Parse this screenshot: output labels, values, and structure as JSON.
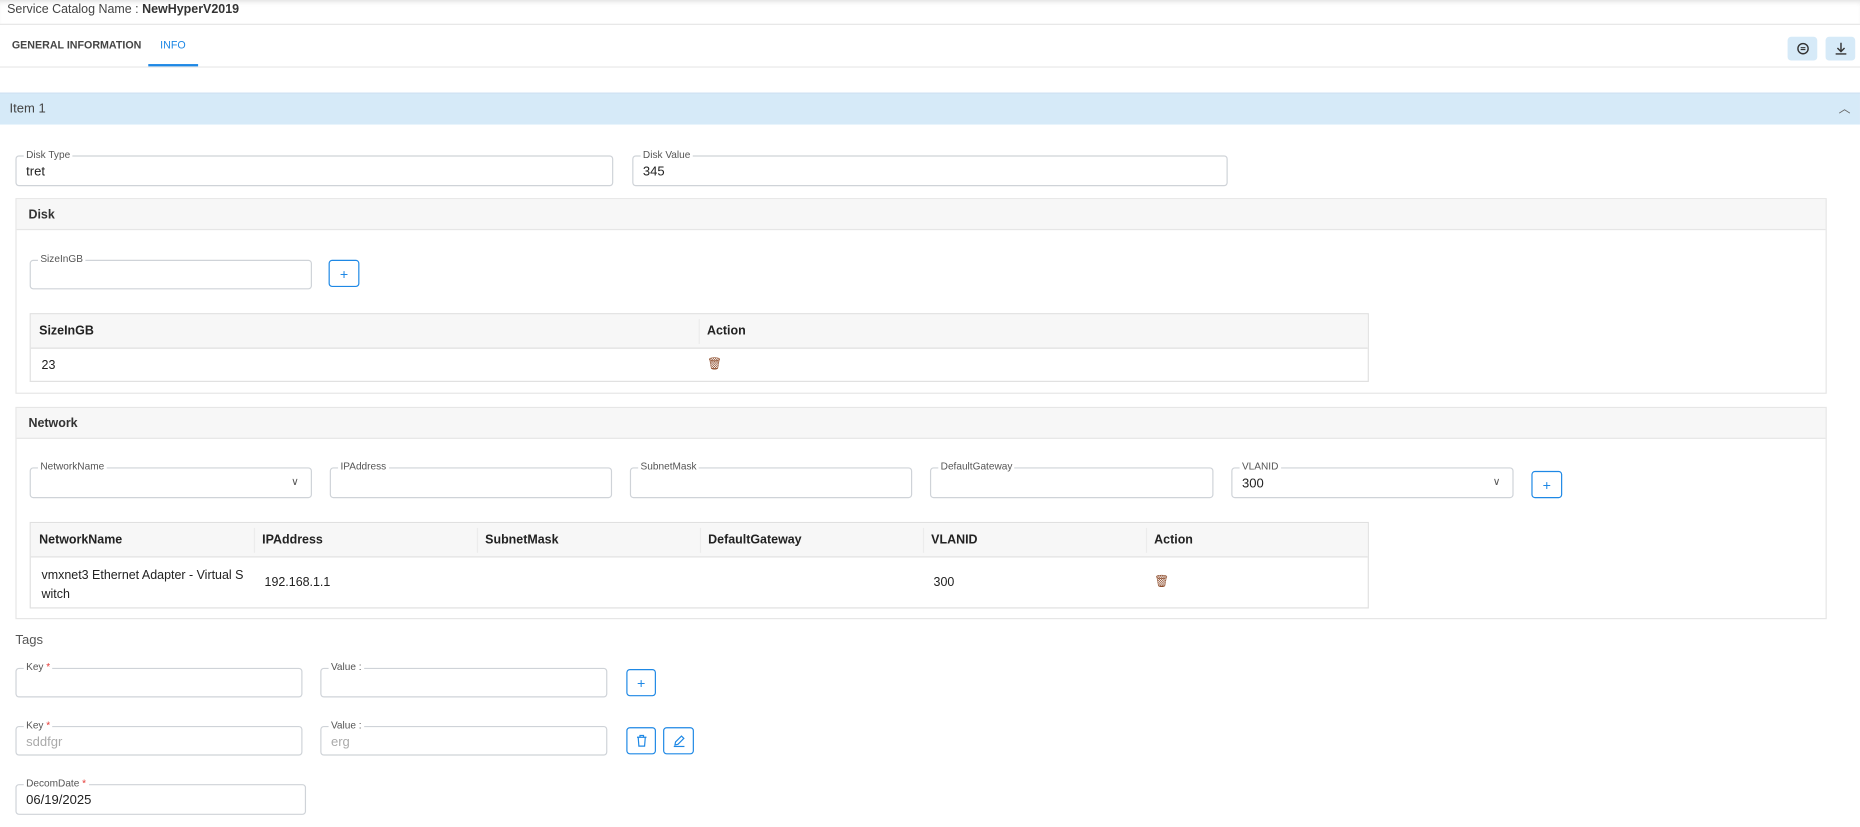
{
  "header": {
    "label": "Service Catalog Name :",
    "name": "NewHyperV2019"
  },
  "tabs": [
    {
      "label": "GENERAL INFORMATION"
    },
    {
      "label": "INFO"
    }
  ],
  "toolbar": {
    "icons": [
      "sync-icon",
      "download-icon"
    ]
  },
  "item": {
    "title": "Item 1"
  },
  "fields": {
    "disk_type": {
      "label": "Disk Type",
      "value": "tret"
    },
    "disk_value": {
      "label": "Disk Value",
      "value": "345"
    }
  },
  "disk": {
    "title": "Disk",
    "size_label": "SizeInGB",
    "add": "+",
    "columns": [
      "SizeInGB",
      "Action"
    ],
    "rows": [
      {
        "size": "23"
      }
    ]
  },
  "network": {
    "title": "Network",
    "inputs": {
      "network_name": "NetworkName",
      "ip": "IPAddress",
      "subnet": "SubnetMask",
      "gateway": "DefaultGateway",
      "vlan": "VLANID",
      "vlan_value": "300"
    },
    "add": "+",
    "columns": [
      "NetworkName",
      "IPAddress",
      "SubnetMask",
      "DefaultGateway",
      "VLANID",
      "Action"
    ],
    "rows": [
      {
        "name": "vmxnet3 Ethernet Adapter - Virtual Switch",
        "ip": "192.168.1.1",
        "subnet": "",
        "gateway": "",
        "vlan": "300"
      }
    ]
  },
  "tags": {
    "title": "Tags",
    "key_label": "Key",
    "value_label": "Value :",
    "required": "*",
    "add": "+",
    "rows": [
      {
        "key": "sddfgr",
        "value": "erg"
      }
    ]
  },
  "decom": {
    "label": "DecomDate",
    "required": "*",
    "value": "06/19/2025"
  },
  "colors": {
    "accent": "#1e88e5",
    "band": "#d6eaf8",
    "trash": "#8d4b2a"
  }
}
